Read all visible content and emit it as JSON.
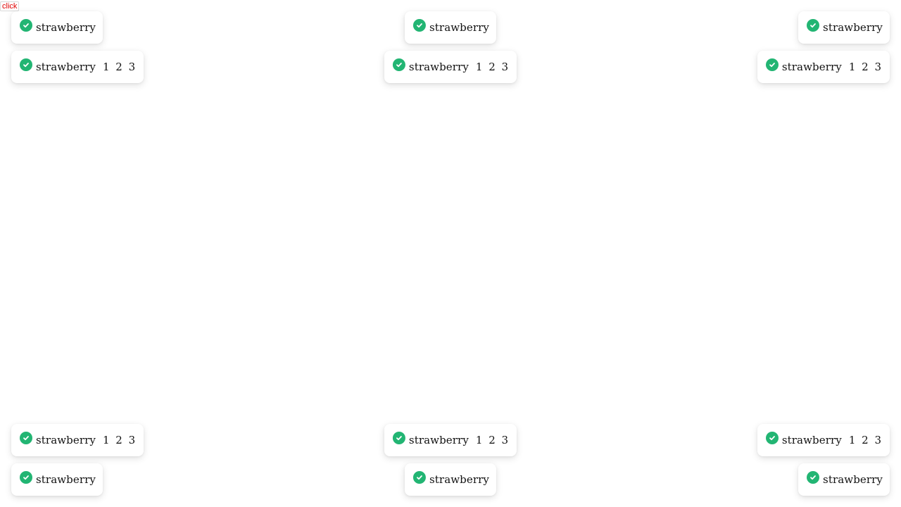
{
  "trigger": {
    "label": "click"
  },
  "toast": {
    "message": "strawberry",
    "extra": "1 2 3"
  },
  "colors": {
    "success": "#22b573",
    "trigger_text": "#e00000"
  },
  "icons": {
    "toast": "check-circle-icon"
  }
}
